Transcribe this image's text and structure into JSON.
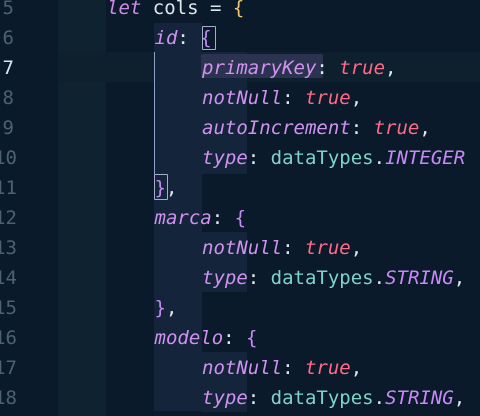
{
  "editor": {
    "lines": [
      {
        "num": "5",
        "indent": 0,
        "tokens": [
          {
            "t": "let",
            "c": "kw"
          },
          {
            "t": " cols ",
            "c": "id"
          },
          {
            "t": "=",
            "c": "punc"
          },
          {
            "t": " ",
            "c": "punc"
          },
          {
            "t": "{",
            "c": "brace"
          }
        ]
      },
      {
        "num": "6",
        "indent": 1,
        "tokens": [
          {
            "t": "id",
            "c": "prop"
          },
          {
            "t": ": ",
            "c": "punc"
          },
          {
            "t": "{",
            "c": "brace2"
          }
        ]
      },
      {
        "num": "7",
        "indent": 2,
        "tokens": [
          {
            "t": "primaryKey",
            "c": "prop"
          },
          {
            "t": ": ",
            "c": "punc"
          },
          {
            "t": "true",
            "c": "bool"
          },
          {
            "t": ",",
            "c": "punc"
          }
        ]
      },
      {
        "num": "8",
        "indent": 2,
        "tokens": [
          {
            "t": "notNull",
            "c": "prop"
          },
          {
            "t": ": ",
            "c": "punc"
          },
          {
            "t": "true",
            "c": "bool"
          },
          {
            "t": ",",
            "c": "punc"
          }
        ]
      },
      {
        "num": "9",
        "indent": 2,
        "tokens": [
          {
            "t": "autoIncrement",
            "c": "prop"
          },
          {
            "t": ": ",
            "c": "punc"
          },
          {
            "t": "true",
            "c": "bool"
          },
          {
            "t": ",",
            "c": "punc"
          }
        ]
      },
      {
        "num": "10",
        "indent": 2,
        "tokens": [
          {
            "t": "type",
            "c": "prop"
          },
          {
            "t": ": ",
            "c": "punc"
          },
          {
            "t": "dataTypes",
            "c": "obj"
          },
          {
            "t": ".",
            "c": "punc"
          },
          {
            "t": "INTEGER",
            "c": "const"
          }
        ]
      },
      {
        "num": "11",
        "indent": 1,
        "tokens": [
          {
            "t": "}",
            "c": "brace2"
          },
          {
            "t": ",",
            "c": "punc"
          }
        ]
      },
      {
        "num": "12",
        "indent": 1,
        "tokens": [
          {
            "t": "marca",
            "c": "prop"
          },
          {
            "t": ": ",
            "c": "punc"
          },
          {
            "t": "{",
            "c": "brace2"
          }
        ]
      },
      {
        "num": "13",
        "indent": 2,
        "tokens": [
          {
            "t": "notNull",
            "c": "prop"
          },
          {
            "t": ": ",
            "c": "punc"
          },
          {
            "t": "true",
            "c": "bool"
          },
          {
            "t": ",",
            "c": "punc"
          }
        ]
      },
      {
        "num": "14",
        "indent": 2,
        "tokens": [
          {
            "t": "type",
            "c": "prop"
          },
          {
            "t": ": ",
            "c": "punc"
          },
          {
            "t": "dataTypes",
            "c": "obj"
          },
          {
            "t": ".",
            "c": "punc"
          },
          {
            "t": "STRING",
            "c": "const"
          },
          {
            "t": ",",
            "c": "punc"
          }
        ]
      },
      {
        "num": "15",
        "indent": 1,
        "tokens": [
          {
            "t": "}",
            "c": "brace2"
          },
          {
            "t": ",",
            "c": "punc"
          }
        ]
      },
      {
        "num": "16",
        "indent": 1,
        "tokens": [
          {
            "t": "modelo",
            "c": "prop"
          },
          {
            "t": ": ",
            "c": "punc"
          },
          {
            "t": "{",
            "c": "brace2"
          }
        ]
      },
      {
        "num": "17",
        "indent": 2,
        "tokens": [
          {
            "t": "notNull",
            "c": "prop"
          },
          {
            "t": ": ",
            "c": "punc"
          },
          {
            "t": "true",
            "c": "bool"
          },
          {
            "t": ",",
            "c": "punc"
          }
        ]
      },
      {
        "num": "18",
        "indent": 2,
        "tokens": [
          {
            "t": "type",
            "c": "prop"
          },
          {
            "t": ": ",
            "c": "punc"
          },
          {
            "t": "dataTypes",
            "c": "obj"
          },
          {
            "t": ".",
            "c": "punc"
          },
          {
            "t": "STRING",
            "c": "const"
          },
          {
            "t": ",",
            "c": "punc"
          }
        ]
      }
    ],
    "active_line": "7"
  },
  "theme": {
    "background": "#0b1a2a",
    "keyword": "#cb8ce8",
    "property": "#cf93ef",
    "boolean": "#ff6a87",
    "object": "#7fd3c9",
    "brace": "#f0c86c"
  }
}
